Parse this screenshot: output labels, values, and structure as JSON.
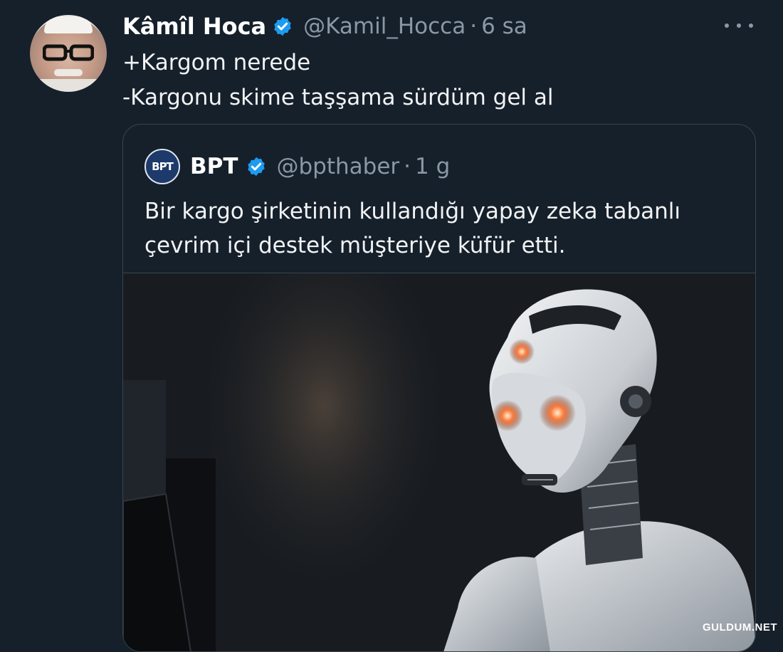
{
  "tweet": {
    "display_name": "Kâmîl Hoca",
    "handle": "@Kamil_Hocca",
    "separator": "·",
    "time": "6 sa",
    "lines": [
      "+Kargom nerede",
      "-Kargonu skime taşşama sürdüm gel al"
    ]
  },
  "quote": {
    "avatar_label": "BPT",
    "display_name": "BPT",
    "handle": "@bpthaber",
    "separator": "·",
    "time": "1 g",
    "lines": [
      "Bir kargo şirketinin kullandığı yapay zeka tabanlı",
      "çevrim içi destek müşteriye küfür etti."
    ]
  },
  "watermark": "GULDUM.NET",
  "colors": {
    "background": "#15202b",
    "verified": "#1d9bf0",
    "secondary_text": "#8b98a5",
    "border": "#38444d",
    "robot_eyes": "#ff7a3a"
  },
  "icons": {
    "verified": "verified-badge-icon",
    "more": "more-horizontal-icon"
  }
}
